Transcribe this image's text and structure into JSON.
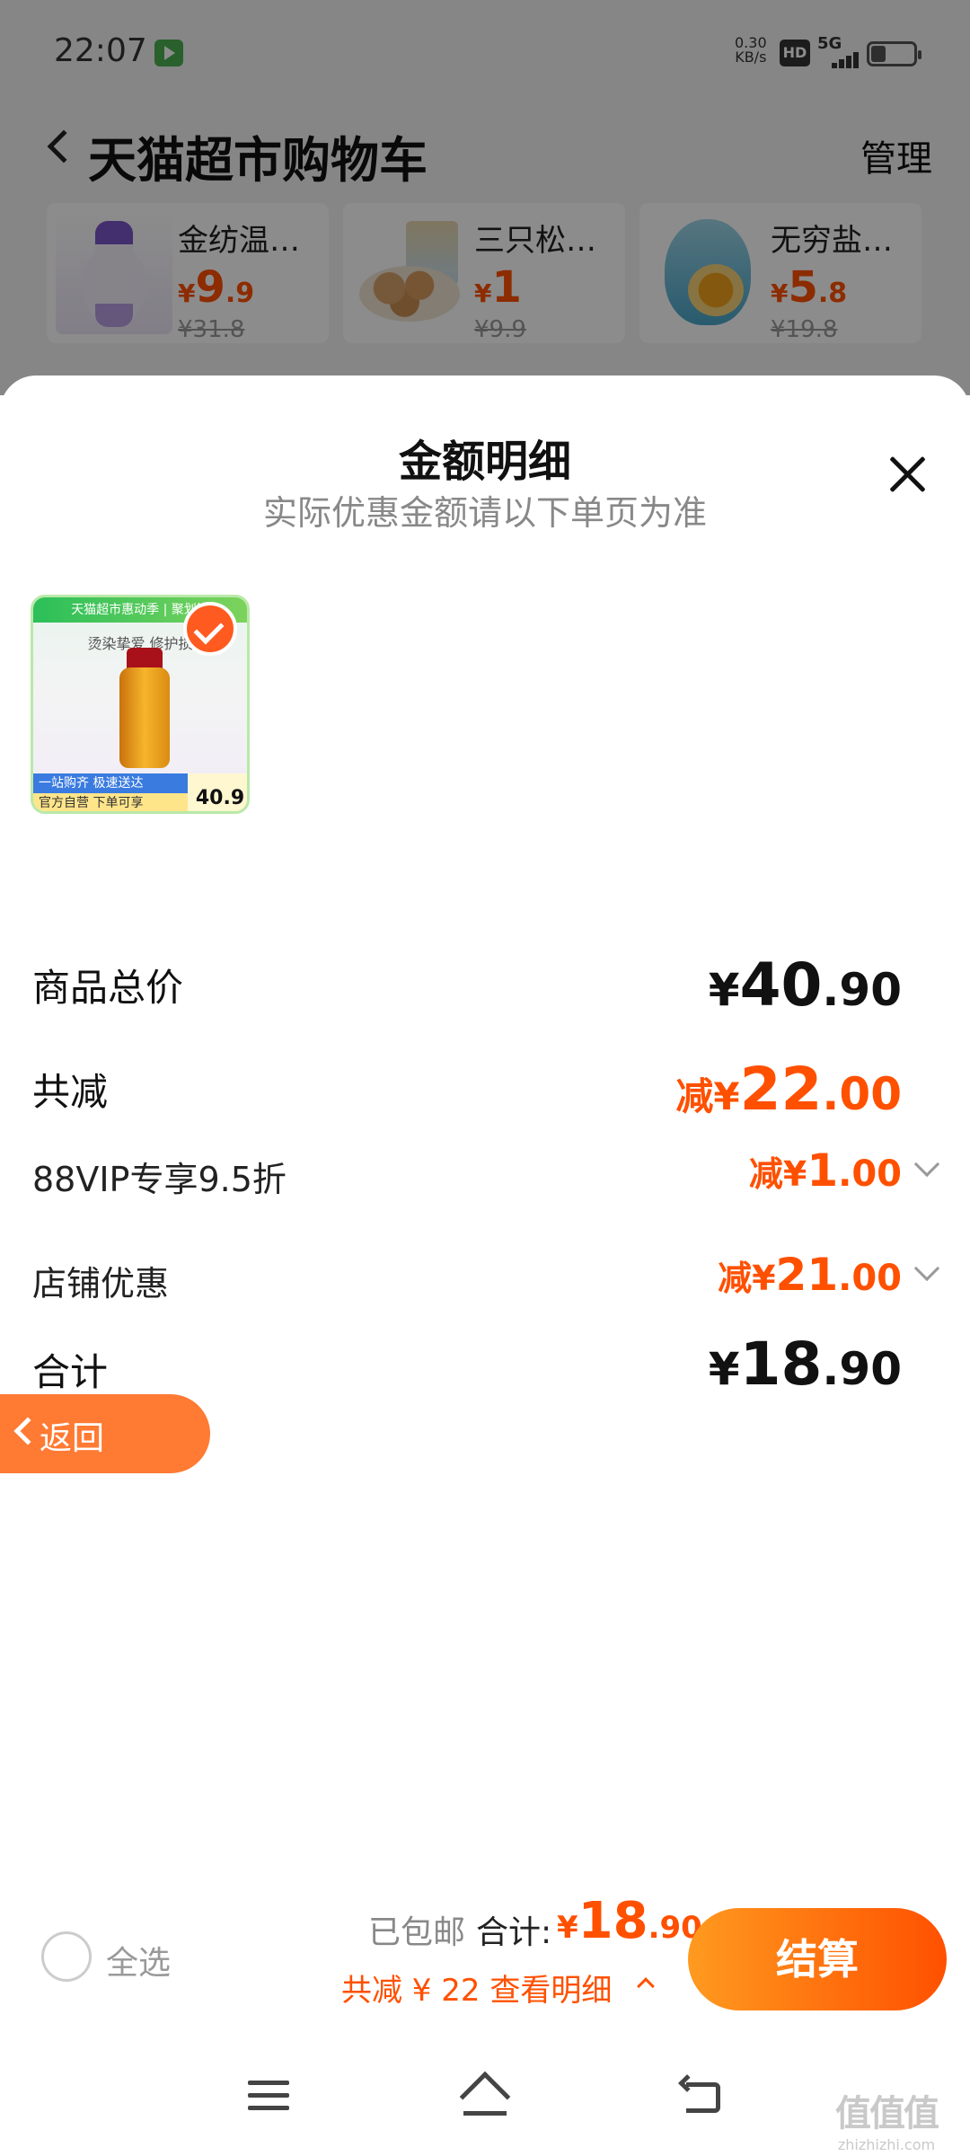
{
  "status_bar": {
    "time": "22:07",
    "net_speed": "0.30",
    "net_unit": "KB/s",
    "hd": "HD",
    "network": "5G"
  },
  "nav": {
    "title": "天猫超市购物车",
    "manage": "管理"
  },
  "recommendations": [
    {
      "name": "金纺温…",
      "price_int": "9",
      "price_dec": ".9",
      "old_price": "¥31.8",
      "image": "detergent-bottle"
    },
    {
      "name": "三只松…",
      "price_int": "1",
      "price_dec": "",
      "old_price": "¥9.9",
      "image": "nuts-bowl"
    },
    {
      "name": "无穷盐…",
      "price_int": "5",
      "price_dec": ".8",
      "old_price": "¥19.8",
      "image": "salted-egg"
    }
  ],
  "currency": "¥",
  "sheet": {
    "title": "金额明细",
    "subtitle": "实际优惠金额请以下单页为准",
    "product": {
      "banner": "天猫超市惠动季 | 聚划算",
      "slogan": "烫染挚爱 修护损",
      "foot_top": "一站购齐 极速送达",
      "foot_bottom": "官方自营 下单可享",
      "price_tag": "40.9",
      "selected": true
    },
    "rows": {
      "goods_total": {
        "label": "商品总价",
        "int": "40",
        "dec": ".90"
      },
      "total_discount": {
        "label": "共减",
        "prefix": "减¥",
        "int": "22",
        "dec": ".00"
      },
      "vip_discount": {
        "label": "88VIP专享9.5折",
        "prefix": "减¥",
        "int": "1",
        "dec": ".00"
      },
      "store_discount": {
        "label": "店铺优惠",
        "prefix": "减¥",
        "int": "21",
        "dec": ".00"
      },
      "sum": {
        "label": "合计",
        "int": "18",
        "dec": ".90"
      }
    },
    "return_label": "返回"
  },
  "checkout": {
    "select_all": "全选",
    "free_shipping": "已包邮",
    "total_label": "合计:",
    "total_int": "18",
    "total_dec": ".90",
    "discount_line": "共减 ¥ 22  查看明细",
    "button": "结算"
  },
  "watermark": {
    "big": "值值值",
    "small": "zhizhizhi.com"
  },
  "colors": {
    "accent": "#ff5000",
    "button_start": "#ff9a1f",
    "return_button": "#ff7a33"
  }
}
